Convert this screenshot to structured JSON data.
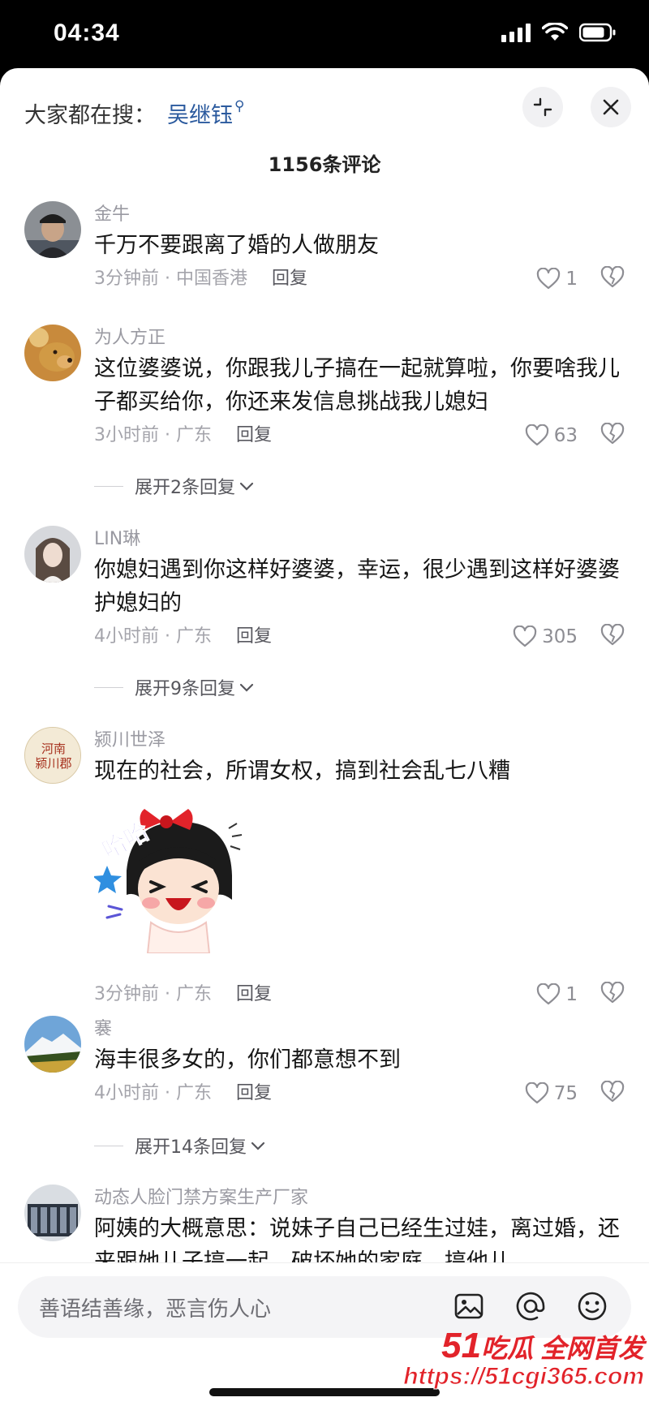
{
  "status_bar": {
    "time": "04:34"
  },
  "header": {
    "search_prefix": "大家都在搜：",
    "search_term": "吴继钰",
    "comment_count": "1156条评论"
  },
  "comments": [
    {
      "name": "金牛",
      "text": "千万不要跟离了婚的人做朋友",
      "meta": "3分钟前 · 中国香港",
      "reply": "回复",
      "likes": "1"
    },
    {
      "name": "为人方正",
      "text": "这位婆婆说，你跟我儿子搞在一起就算啦，你要啥我儿子都买给你，你还来发信息挑战我儿媳妇",
      "meta": "3小时前 · 广东",
      "reply": "回复",
      "likes": "63",
      "expand": "展开2条回复"
    },
    {
      "name": "LIN琳",
      "text": "你媳妇遇到你这样好婆婆，幸运，很少遇到这样好婆婆护媳妇的",
      "meta": "4小时前 · 广东",
      "reply": "回复",
      "likes": "305",
      "expand": "展开9条回复"
    },
    {
      "name": "颍川世泽",
      "text": "现在的社会，所谓女权，搞到社会乱七八糟",
      "meta": "3分钟前 · 广东",
      "reply": "回复",
      "likes": "1",
      "avatar_text": "河南颍川郡",
      "sticker_text": "哈哈"
    },
    {
      "name": "褰",
      "text": "海丰很多女的，你们都意想不到",
      "meta": "4小时前 · 广东",
      "reply": "回复",
      "likes": "75",
      "expand": "展开14条回复"
    },
    {
      "name": "动态人脸门禁方案生产厂家",
      "text": "阿姨的大概意思：说妹子自己已经生过娃，离过婚，还来跟她儿子搞一起，破坏她的家庭，搞他儿"
    }
  ],
  "input": {
    "placeholder": "善语结善缘，恶言伤人心"
  },
  "watermark": {
    "brand_num": "51",
    "brand_text": "吃瓜 全网首发",
    "url": "https://51cgi365.com"
  },
  "colors": {
    "link": "#2b5a9e",
    "accent": "#e2232a"
  },
  "icons": [
    "signal-icon",
    "wifi-icon",
    "battery-icon",
    "collapse-icon",
    "close-icon",
    "heart-icon",
    "dislike-heart-icon",
    "image-icon",
    "at-icon",
    "emoji-icon",
    "chevron-down-icon"
  ]
}
